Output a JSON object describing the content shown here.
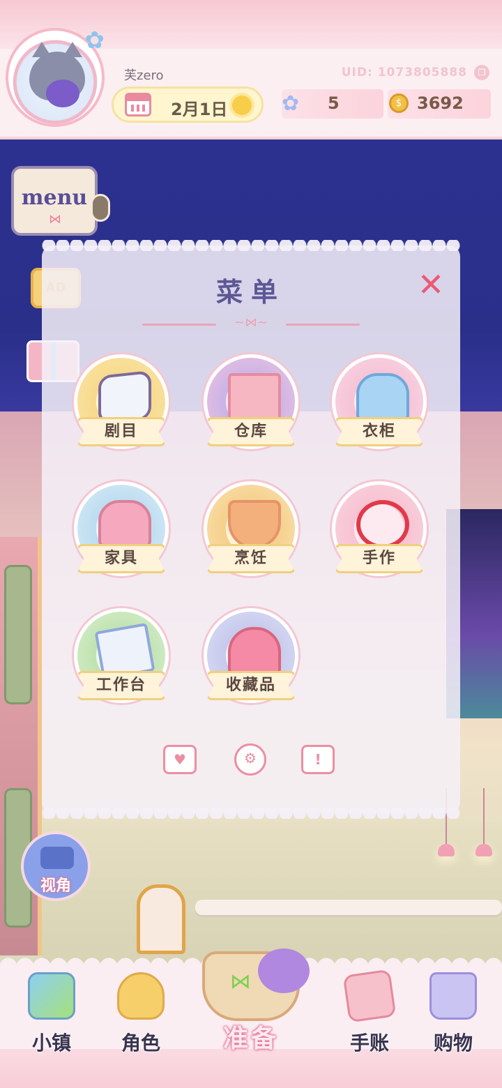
{
  "header": {
    "username": "芙zero",
    "uid": "UID: 1073805888",
    "date": "2月1日",
    "star_count": "5",
    "coin_count": "3692"
  },
  "side": {
    "menu_label": "menu",
    "ad_label": "AD",
    "view_label": "视角"
  },
  "panel": {
    "title": "菜单",
    "close_glyph": "✕",
    "items": [
      {
        "label": "剧目"
      },
      {
        "label": "仓库"
      },
      {
        "label": "衣柜"
      },
      {
        "label": "家具"
      },
      {
        "label": "烹饪"
      },
      {
        "label": "手作"
      },
      {
        "label": "工作台"
      },
      {
        "label": "收藏品"
      }
    ],
    "bottom_icons": [
      "mail-icon",
      "settings-gear-icon",
      "notice-icon"
    ]
  },
  "nav": {
    "items": [
      {
        "label": "小镇",
        "icon": "map-icon"
      },
      {
        "label": "角色",
        "icon": "character-icon"
      },
      {
        "label": "准备",
        "icon": "basket-icon"
      },
      {
        "label": "手账",
        "icon": "journal-icon"
      },
      {
        "label": "购物",
        "icon": "shopping-bag-icon"
      }
    ]
  },
  "colors": {
    "accent_pink": "#ea5a75",
    "title_purple": "#5c5896",
    "ribbon_gold": "#f0cf7e",
    "night_sky": "#2c3190"
  }
}
